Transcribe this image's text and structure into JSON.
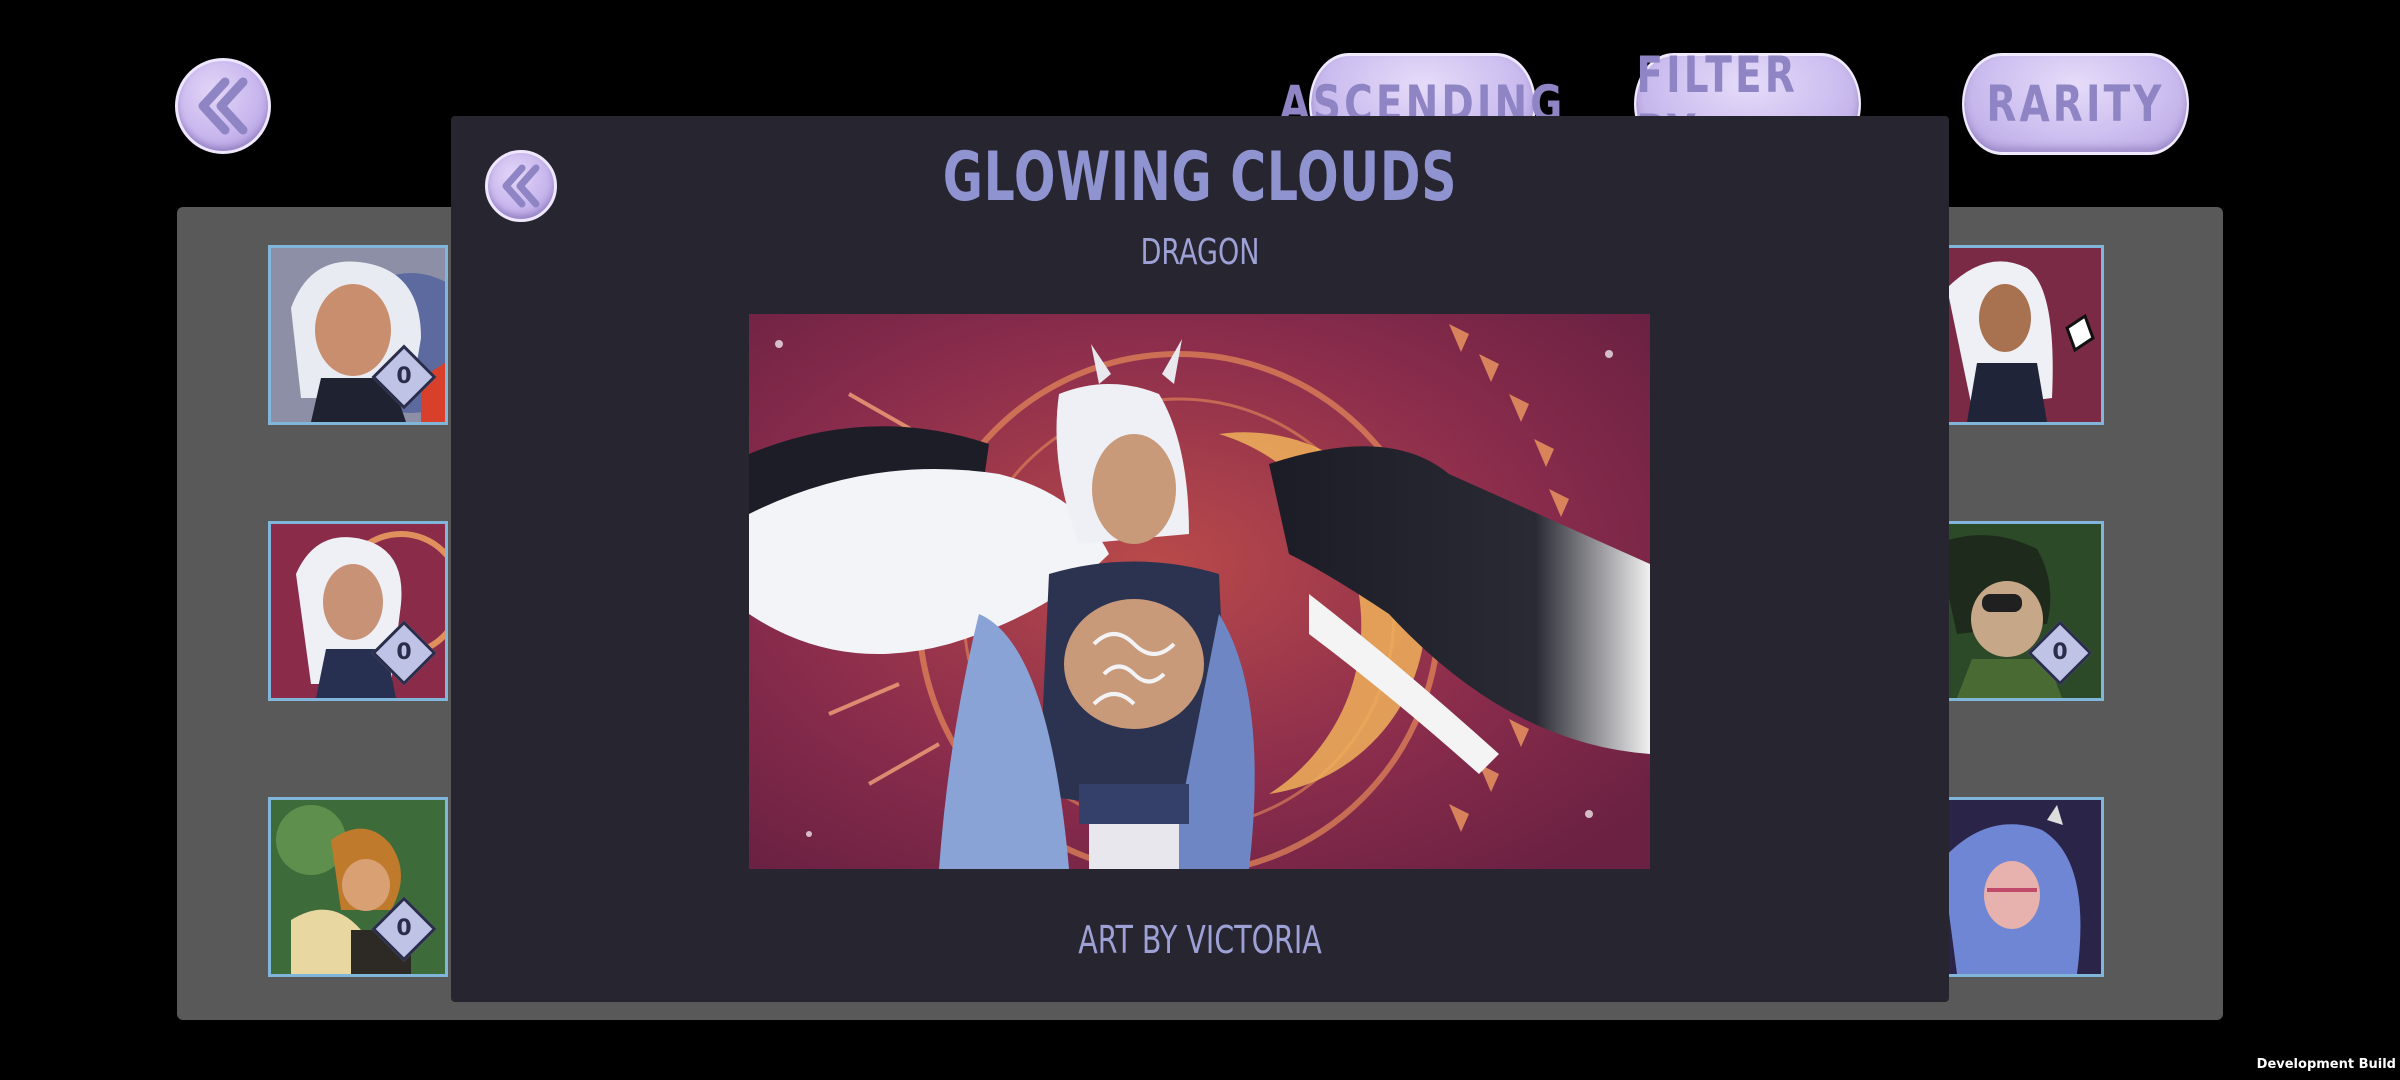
{
  "toolbar": {
    "back_icon": "double-chevron-left-icon",
    "sort_label": "ASCENDING",
    "filter_label": "FILTER BY",
    "rarity_label": "RARITY"
  },
  "gallery": {
    "cards": [
      {
        "rank": "0"
      },
      {
        "rank": "0"
      },
      {
        "rank": "0"
      },
      {
        "rank": ""
      },
      {
        "rank": "0"
      },
      {
        "rank": ""
      }
    ]
  },
  "modal": {
    "close_icon": "double-chevron-left-icon",
    "title": "GLOWING CLOUDS",
    "subtitle": "DRAGON",
    "credit": "ART BY VICTORIA"
  },
  "footer": {
    "build_label": "Development Build"
  },
  "colors": {
    "background": "#000000",
    "panel": "#595959",
    "modal": "#272530",
    "accent": "#8f93cf",
    "button": "#c8b6ee",
    "card_border": "#7fb6d9"
  }
}
